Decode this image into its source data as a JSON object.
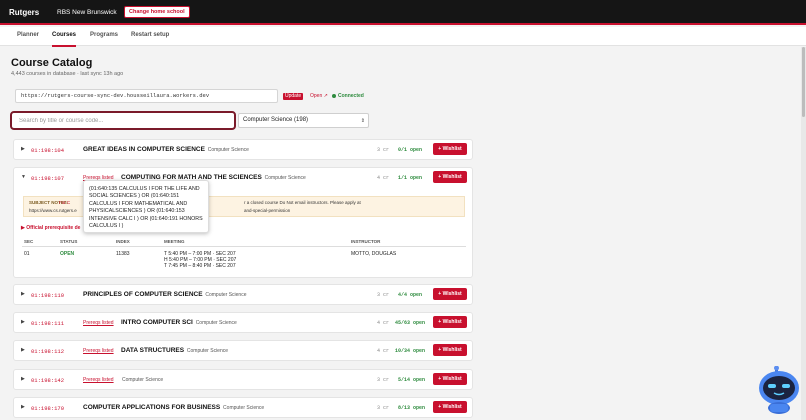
{
  "header": {
    "brand": "Rutgers",
    "campus": "RBS New Brunswick",
    "change_school": "Change home school"
  },
  "nav": {
    "tabs": [
      {
        "label": "Planner"
      },
      {
        "label": "Courses"
      },
      {
        "label": "Programs"
      },
      {
        "label": "Restart setup"
      }
    ],
    "active": "Courses"
  },
  "catalog": {
    "title": "Course Catalog",
    "subtitle": "4,443 courses in database · last sync 13h ago",
    "sync_url": "https://rutgers-course-sync-dev.housseillaura.workers.dev",
    "update_label": "Update",
    "open_label": "Open ↗",
    "status": "Connected"
  },
  "search": {
    "placeholder": "Search by title or course code...",
    "subject_selected": "Computer Science (198)"
  },
  "wishlist_label": "+ Wishlist",
  "prereq_badge": "Prereqs listed",
  "courses": [
    {
      "code": "01:198:104",
      "title": "GREAT IDEAS IN COMPUTER SCIENCE",
      "dept": "Computer Science",
      "credits": "3 cr",
      "open": "0/1 open",
      "prereqs": false,
      "expanded": false
    },
    {
      "code": "01:198:107",
      "title": "COMPUTING FOR MATH AND THE SCIENCES",
      "dept": "Computer Science",
      "credits": "4 cr",
      "open": "1/1 open",
      "prereqs": true,
      "expanded": true
    },
    {
      "code": "01:198:110",
      "title": "PRINCIPLES OF COMPUTER SCIENCE",
      "dept": "Computer Science",
      "credits": "3 cr",
      "open": "4/4 open",
      "prereqs": false,
      "expanded": false
    },
    {
      "code": "01:198:111",
      "title": "INTRO COMPUTER SCI",
      "dept": "Computer Science",
      "credits": "4 cr",
      "open": "45/63 open",
      "prereqs": true,
      "expanded": false
    },
    {
      "code": "01:198:112",
      "title": "DATA STRUCTURES",
      "dept": "Computer Science",
      "credits": "4 cr",
      "open": "10/34 open",
      "prereqs": true,
      "expanded": false
    },
    {
      "code": "01:198:142",
      "title": "",
      "dept": "Computer Science",
      "credits": "3 cr",
      "open": "5/14 open",
      "prereqs": true,
      "expanded": false
    },
    {
      "code": "01:198:170",
      "title": "COMPUTER APPLICATIONS FOR BUSINESS",
      "dept": "Computer Science",
      "credits": "3 cr",
      "open": "8/13 open",
      "prereqs": false,
      "expanded": false
    }
  ],
  "detail": {
    "notes_label": "SUBJECT NOTES:",
    "notes_text": "For C",
    "notes_url": "https://www.cs.rutgers.e",
    "notes_right_1": "r a closed course Do Not email instructors. Please apply at",
    "notes_right_2": "and-special-permission",
    "prereq_link": "▶ Official prerequisite de",
    "columns": [
      "SEC",
      "STATUS",
      "INDEX",
      "MEETING",
      "INSTRUCTOR"
    ],
    "section": {
      "sec": "01",
      "status": "OPEN",
      "index": "11383",
      "meetings": [
        "T 5:40 PM – 7:00 PM · SEC 207",
        "H 5:40 PM – 7:00 PM · SEC 207",
        "T 7:45 PM – 8:40 PM · SEC 207"
      ],
      "instructor": "MOTTO, DOUGLAS"
    }
  },
  "tooltip": {
    "lines": [
      "(01:640:135 CALCULUS I FOR THE LIFE AND",
      "SOCIAL SCIENCES ) OR (01:640:151",
      "CALCULUS I FOR MATHEMATICAL AND",
      "PHYSICALSCIENCES ) OR (01:640:153",
      "INTENSIVE CALC I ) OR (01:640:191 HONORS",
      "CALCULUS I )"
    ]
  },
  "colors": {
    "brand_red": "#c8102e",
    "open_green": "#2e8b3e",
    "topbar": "#151515"
  }
}
